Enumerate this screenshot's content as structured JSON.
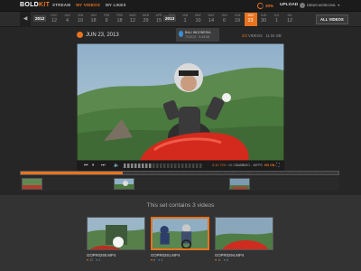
{
  "header": {
    "logo_a": "BOLD",
    "logo_b": "KIT",
    "nav": [
      "STREAM",
      "MY VIDEOS",
      "MY LIKES"
    ],
    "storage_pct": "30%",
    "upload_label": "UPLOAD",
    "user_name": "DENIS MOSKOVA"
  },
  "timeline": {
    "years": [
      "2012",
      "2013"
    ],
    "days_a": [
      {
        "m": "DEC",
        "d": "12"
      },
      {
        "m": "JAN",
        "d": "4"
      },
      {
        "m": "JAN",
        "d": "10"
      },
      {
        "m": "JAN",
        "d": "18"
      },
      {
        "m": "FEB",
        "d": "9"
      },
      {
        "m": "FEB",
        "d": "18"
      },
      {
        "m": "MAR",
        "d": "12"
      },
      {
        "m": "MAR",
        "d": "29"
      },
      {
        "m": "APR",
        "d": "15"
      },
      {
        "m": "MAY",
        "d": "25"
      }
    ],
    "days_b": [
      {
        "m": "JAN",
        "d": "1"
      },
      {
        "m": "MAY",
        "d": "10"
      },
      {
        "m": "MAY",
        "d": "14"
      },
      {
        "m": "JUN",
        "d": "6"
      },
      {
        "m": "JUN",
        "d": "19"
      },
      {
        "m": "JUN",
        "d": "23"
      },
      {
        "m": "JUN",
        "d": "30"
      },
      {
        "m": "JUL",
        "d": "1"
      },
      {
        "m": "JUL",
        "d": "12"
      }
    ],
    "active_index_b": 5,
    "all_videos_label": "ALL VIDEOS"
  },
  "info": {
    "date": "JUN 23, 2013",
    "location_line1": "BALI INDONESIA",
    "location_line2": "7/23/13 · 9:43:08",
    "videos_count": "2/3",
    "videos_word": "VIDEOS",
    "size": "11.04 GB"
  },
  "player": {
    "current_time": "3:10.729",
    "total_time": "/ 08:31.412",
    "quality": "SLOWMO - 48FPS",
    "hd": "HD ON",
    "progress": 0.32
  },
  "set": {
    "title": "This set contains 3 videos",
    "videos": [
      {
        "name": "GOPR0290.MP4",
        "likes": "12",
        "comments": "2"
      },
      {
        "name": "GOPR0291.MP4",
        "likes": "8",
        "comments": "4"
      },
      {
        "name": "GOPR0294.MP4",
        "likes": "11",
        "comments": "6"
      }
    ]
  },
  "colors": {
    "accent": "#e8731e",
    "info": "#3b8fd4"
  }
}
